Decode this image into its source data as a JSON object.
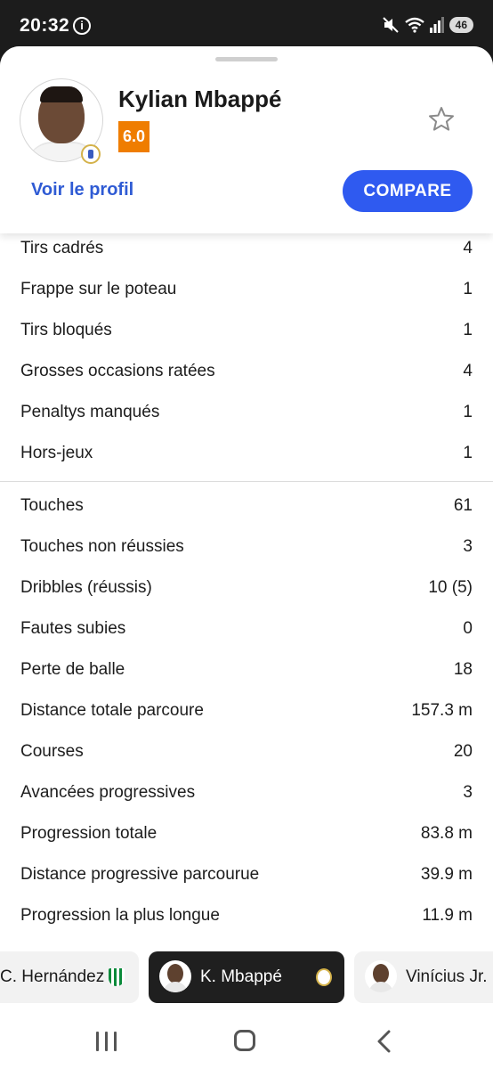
{
  "status_bar": {
    "time": "20:32",
    "info_glyph": "i",
    "battery": "46",
    "icons": [
      "mute-icon",
      "wifi-icon",
      "signal-icon",
      "battery-icon"
    ]
  },
  "player": {
    "name": "Kylian Mbappé",
    "rating": "6.0",
    "rating_color": "#ef7d00"
  },
  "actions": {
    "profile_link": "Voir le profil",
    "compare_label": "COMPARE",
    "accent_color": "#2f5af0"
  },
  "stats_group_1": [
    {
      "label": "Tirs cadrés",
      "value": "4"
    },
    {
      "label": "Frappe sur le poteau",
      "value": "1"
    },
    {
      "label": "Tirs bloqués",
      "value": "1"
    },
    {
      "label": "Grosses occasions ratées",
      "value": "4"
    },
    {
      "label": "Penaltys manqués",
      "value": "1"
    },
    {
      "label": "Hors-jeux",
      "value": "1"
    }
  ],
  "stats_group_2": [
    {
      "label": "Touches",
      "value": "61"
    },
    {
      "label": "Touches non réussies",
      "value": "3"
    },
    {
      "label": "Dribbles (réussis)",
      "value": "10 (5)"
    },
    {
      "label": "Fautes subies",
      "value": "0"
    },
    {
      "label": "Perte de balle",
      "value": "18"
    },
    {
      "label": "Distance totale parcoure",
      "value": "157.3 m"
    },
    {
      "label": "Courses",
      "value": "20"
    },
    {
      "label": "Avancées progressives",
      "value": "3"
    },
    {
      "label": "Progression totale",
      "value": "83.8 m"
    },
    {
      "label": "Distance progressive parcourue",
      "value": "39.9 m"
    },
    {
      "label": "Progression la plus longue",
      "value": "11.9 m"
    }
  ],
  "player_strip": [
    {
      "name": "C. Hernández",
      "active": false
    },
    {
      "name": "K. Mbappé",
      "active": true
    },
    {
      "name": "Vinícius Jr.",
      "active": false
    }
  ]
}
